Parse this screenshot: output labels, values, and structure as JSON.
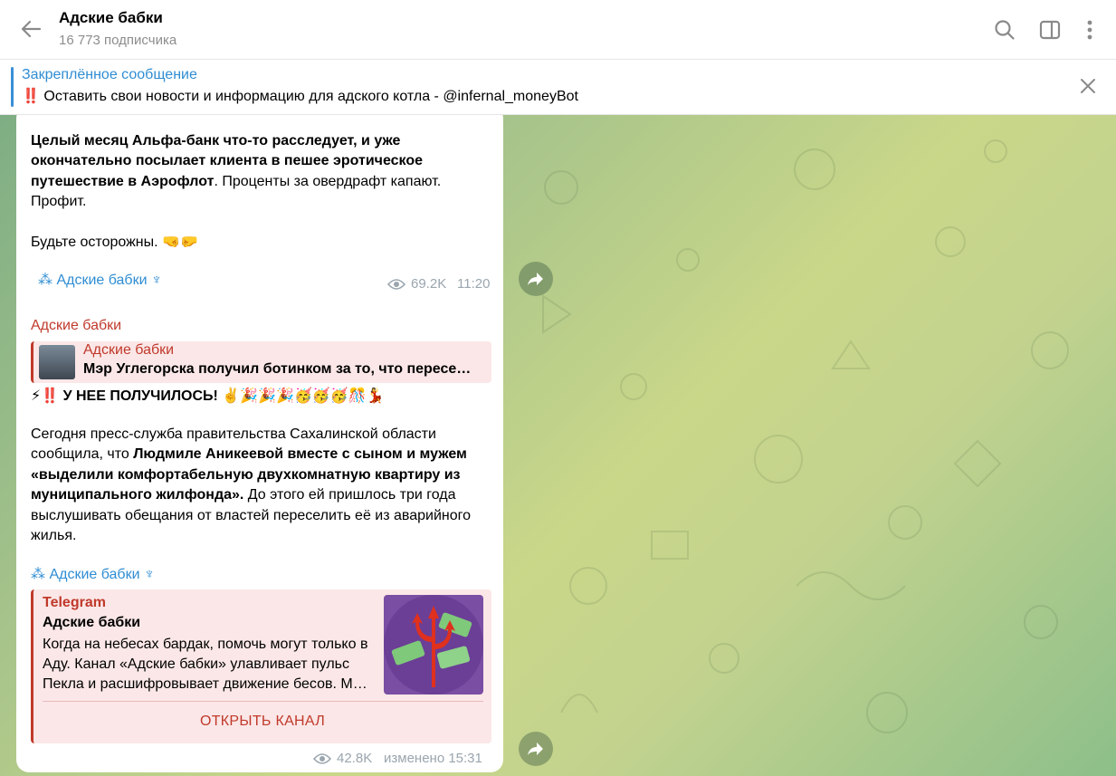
{
  "header": {
    "title": "Адские бабки",
    "subtitle": "16 773 подписчика"
  },
  "pinned": {
    "label": "Закреплённое сообщение",
    "text": "‼️ Оставить свои новости и информацию для адского котла - @infernal_moneyBot"
  },
  "message1": {
    "text_bold": "Целый месяц Альфа-банк что-то расследует, и  уже окончательно посылает клиента в пешее эротическое путешествие в Аэрофлот",
    "text_rest": ". Проценты за овердрафт капают. Профит.",
    "text_tail": "Будьте осторожны. 🤜🤛",
    "signature": "⁂ Адские бабки ♆",
    "views": "69.2K",
    "time": "11:20"
  },
  "message2": {
    "author": "Адские бабки",
    "reply_author": "Адские бабки",
    "reply_text": "Мэр Углегорска получил ботинком за то, что пересе…",
    "headline": "⚡‼️ У НЕЕ ПОЛУЧИЛОСЬ!  ✌️🎉🎉🎉🥳🥳🥳🎊💃",
    "p_start": "Сегодня пресс-служба правительства Сахалинской области сообщила, что ",
    "p_bold": "Людмиле Аникеевой вместе с сыном и мужем «выделили комфортабельную двухкомнатную квартиру из муниципального жилфонда».",
    "p_end": " До этого ей пришлось три года выслушивать обещания от властей переселить её из аварийного жилья.",
    "signature": "⁂ Адские бабки ♆",
    "preview": {
      "site": "Telegram",
      "title": "Адские бабки",
      "description": "Когда на небесах бардак, помочь могут только в Аду.  Канал «Адские бабки»  улавливает пульс Пекла и расшифровывает движение бесов. М…",
      "button": "ОТКРЫТЬ КАНАЛ"
    },
    "views": "42.8K",
    "time": "изменено 15:31"
  }
}
